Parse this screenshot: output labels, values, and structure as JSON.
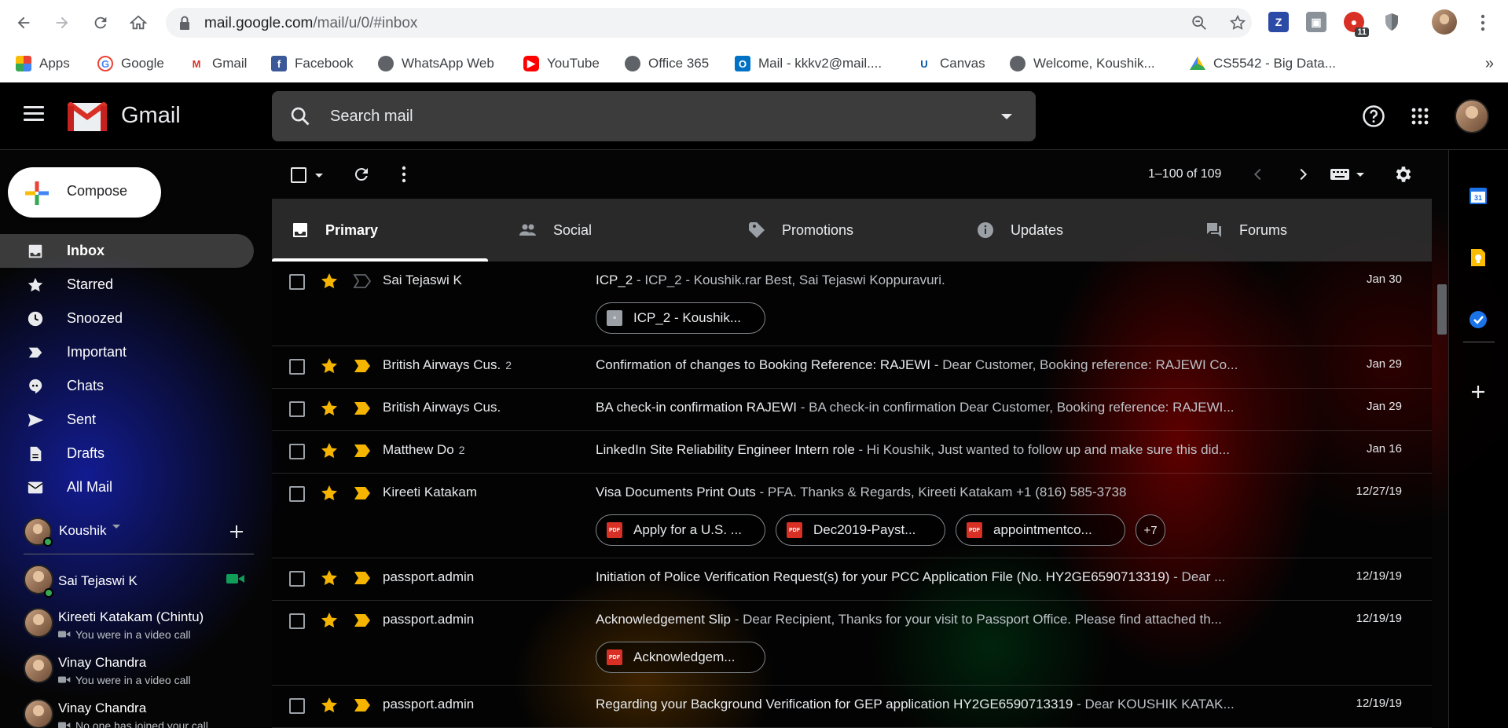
{
  "browser": {
    "url_host": "mail.google.com",
    "url_path": "/mail/u/0/#inbox",
    "extension_badge": "11",
    "bookmarks": [
      {
        "label": "Apps",
        "icon": "apps-grid-icon"
      },
      {
        "label": "Google",
        "icon": "google-icon"
      },
      {
        "label": "Gmail",
        "icon": "gmail-icon"
      },
      {
        "label": "Facebook",
        "icon": "facebook-icon"
      },
      {
        "label": "WhatsApp Web",
        "icon": "globe-icon"
      },
      {
        "label": "YouTube",
        "icon": "youtube-icon"
      },
      {
        "label": "Office 365",
        "icon": "globe-icon"
      },
      {
        "label": "Mail - kkkv2@mail....",
        "icon": "outlook-icon"
      },
      {
        "label": "Canvas",
        "icon": "umkc-icon"
      },
      {
        "label": "Welcome, Koushik...",
        "icon": "globe-icon"
      },
      {
        "label": "CS5542 - Big Data...",
        "icon": "google-drive-icon"
      }
    ],
    "more_bookmarks": "»"
  },
  "gmail": {
    "brand": "Gmail",
    "search_placeholder": "Search mail",
    "compose_label": "Compose",
    "pagination": "1–100 of 109",
    "nav": [
      {
        "label": "Inbox",
        "icon": "inbox-icon",
        "active": true
      },
      {
        "label": "Starred",
        "icon": "star-icon"
      },
      {
        "label": "Snoozed",
        "icon": "clock-icon"
      },
      {
        "label": "Important",
        "icon": "important-icon"
      },
      {
        "label": "Chats",
        "icon": "chat-icon"
      },
      {
        "label": "Sent",
        "icon": "send-icon"
      },
      {
        "label": "Drafts",
        "icon": "draft-icon"
      },
      {
        "label": "All Mail",
        "icon": "mail-icon"
      }
    ],
    "hangouts": {
      "me": "Koushik",
      "contacts": [
        {
          "name": "Sai Tejaswi K",
          "status": ""
        },
        {
          "name": "Kireeti Katakam (Chintu)",
          "status": "You were in a video call"
        },
        {
          "name": "Vinay Chandra",
          "status": "You were in a video call"
        },
        {
          "name": "Vinay Chandra",
          "status": "No one has joined your call"
        }
      ]
    },
    "tabs": [
      {
        "label": "Primary",
        "icon": "inbox-tab-icon",
        "active": true
      },
      {
        "label": "Social",
        "icon": "people-icon"
      },
      {
        "label": "Promotions",
        "icon": "tag-icon"
      },
      {
        "label": "Updates",
        "icon": "info-icon"
      },
      {
        "label": "Forums",
        "icon": "forum-icon"
      }
    ],
    "emails": [
      {
        "from": "Sai Tejaswi K",
        "count": "",
        "subject": "ICP_2",
        "preview": " - ICP_2 - Koushik.rar Best, Sai Tejaswi Koppuravuri.",
        "date": "Jan 30",
        "important": false,
        "attachments": [
          {
            "name": "ICP_2 - Koushik...",
            "type": "archive"
          }
        ],
        "more": ""
      },
      {
        "from": "British Airways Cus.",
        "count": "2",
        "subject": "Confirmation of changes to Booking Reference: RAJEWI",
        "preview": " - Dear Customer, Booking reference: RAJEWI Co...",
        "date": "Jan 29",
        "important": true,
        "attachments": [],
        "more": ""
      },
      {
        "from": "British Airways Cus.",
        "count": "",
        "subject": "BA check-in confirmation RAJEWI",
        "preview": " - BA check-in confirmation Dear Customer, Booking reference: RAJEWI...",
        "date": "Jan 29",
        "important": true,
        "attachments": [],
        "more": ""
      },
      {
        "from": "Matthew Do",
        "count": "2",
        "subject": "LinkedIn Site Reliability Engineer Intern role",
        "preview": " - Hi Koushik, Just wanted to follow up and make sure this did...",
        "date": "Jan 16",
        "important": true,
        "attachments": [],
        "more": ""
      },
      {
        "from": "Kireeti Katakam",
        "count": "",
        "subject": "Visa Documents Print Outs",
        "preview": " - PFA. Thanks & Regards, Kireeti Katakam +1 (816) 585-3738",
        "date": "12/27/19",
        "important": true,
        "attachments": [
          {
            "name": "Apply for a U.S. ...",
            "type": "pdf"
          },
          {
            "name": "Dec2019-Payst...",
            "type": "pdf"
          },
          {
            "name": "appointmentco...",
            "type": "pdf"
          }
        ],
        "more": "+7"
      },
      {
        "from": "passport.admin",
        "count": "",
        "subject": "Initiation of Police Verification Request(s) for your PCC Application File (No. HY2GE6590713319)",
        "preview": " - Dear ...",
        "date": "12/19/19",
        "important": true,
        "attachments": [],
        "more": ""
      },
      {
        "from": "passport.admin",
        "count": "",
        "subject": "Acknowledgement Slip",
        "preview": " - Dear Recipient, Thanks for your visit to Passport Office. Please find attached th...",
        "date": "12/19/19",
        "important": true,
        "attachments": [
          {
            "name": "Acknowledgem...",
            "type": "pdf"
          }
        ],
        "more": ""
      },
      {
        "from": "passport.admin",
        "count": "",
        "subject": "Regarding your Background Verification for GEP application HY2GE6590713319",
        "preview": " - Dear KOUSHIK KATAK...",
        "date": "12/19/19",
        "important": true,
        "attachments": [],
        "more": ""
      }
    ]
  },
  "colors": {
    "star": "#f4b400",
    "important": "#f4b400",
    "pdf": "#d93025",
    "online": "#34a853",
    "video": "#0f9d58"
  }
}
